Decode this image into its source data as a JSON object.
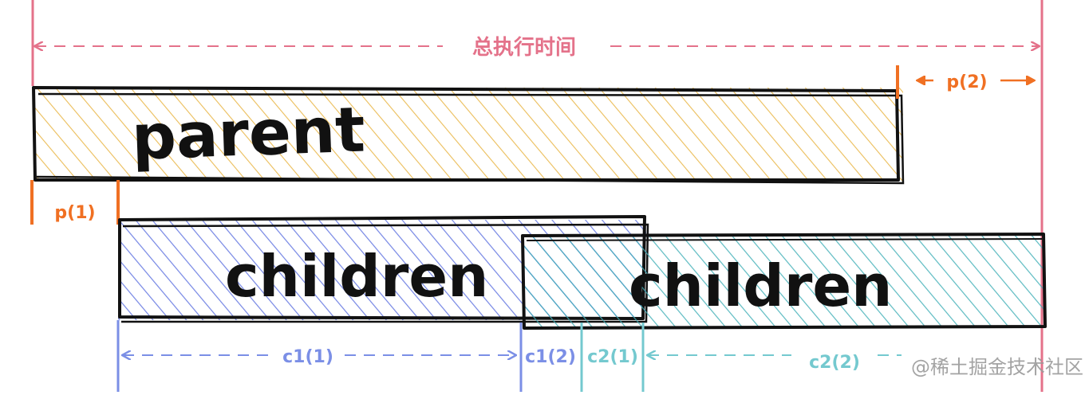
{
  "diagram": {
    "total_time_label": "总执行时间",
    "parent_label": "parent",
    "child1_label": "children",
    "child2_label": "children",
    "p1_label": "p(1)",
    "p2_label": "p(2)",
    "c1_1_label": "c1(1)",
    "c1_2_label": "c1(2)",
    "c2_1_label": "c2(1)",
    "c2_2_label": "c2(2)",
    "watermark": "@稀土掘金技术社区"
  },
  "colors": {
    "total": "#e4728a",
    "parent_fill": "#e8b23a",
    "child1_fill": "#5b6fe0",
    "child2_fill": "#3eaeb6",
    "p_marker": "#f07023",
    "c1_marker": "#7b8fe6",
    "c2_marker": "#74c9cf",
    "outline": "#111111",
    "watermark": "#9a9a9a"
  }
}
